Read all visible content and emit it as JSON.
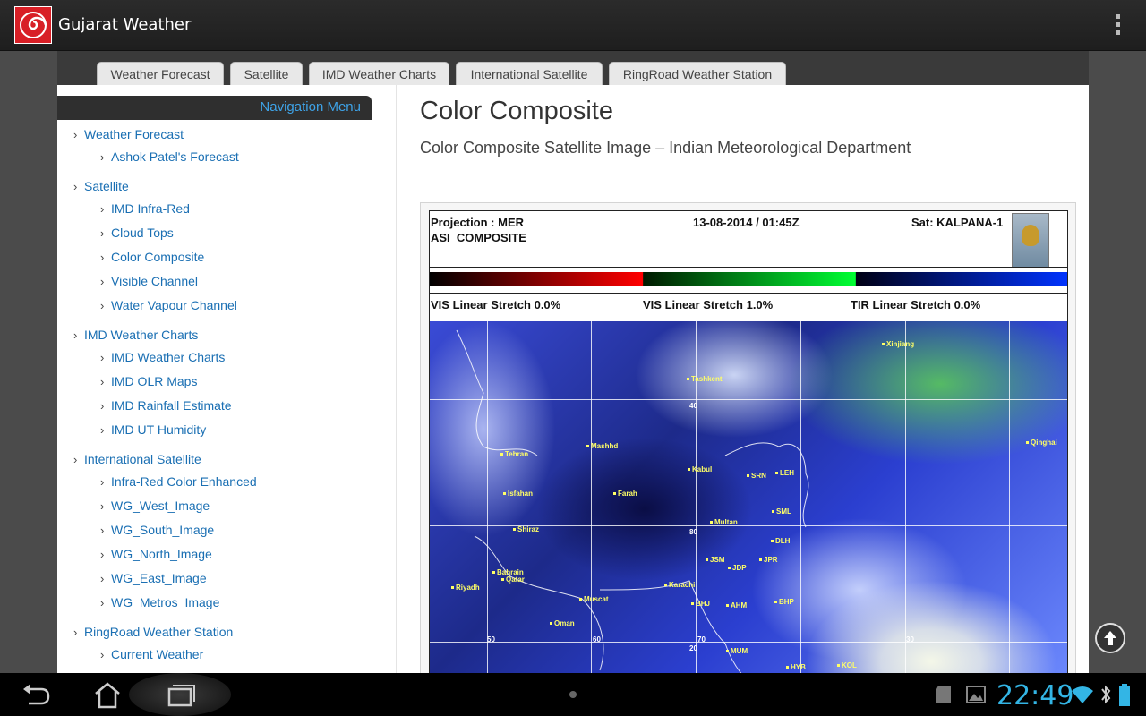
{
  "app": {
    "title": "Gujarat Weather",
    "icon": "spiral-logo-icon"
  },
  "tabs": [
    {
      "label": "Weather Forecast"
    },
    {
      "label": "Satellite"
    },
    {
      "label": "IMD Weather Charts"
    },
    {
      "label": "International Satellite"
    },
    {
      "label": "RingRoad Weather Station"
    }
  ],
  "nav": {
    "heading": "Navigation Menu",
    "items": [
      {
        "label": "Weather Forecast",
        "level": 0
      },
      {
        "label": "Ashok Patel's Forecast",
        "level": 1
      },
      {
        "label": "Satellite",
        "level": 0
      },
      {
        "label": "IMD Infra-Red",
        "level": 1
      },
      {
        "label": "Cloud Tops",
        "level": 1
      },
      {
        "label": "Color Composite",
        "level": 1
      },
      {
        "label": "Visible Channel",
        "level": 1
      },
      {
        "label": "Water Vapour Channel",
        "level": 1
      },
      {
        "label": "IMD Weather Charts",
        "level": 0
      },
      {
        "label": "IMD Weather Charts",
        "level": 1
      },
      {
        "label": "IMD OLR Maps",
        "level": 1
      },
      {
        "label": "IMD Rainfall Estimate",
        "level": 1
      },
      {
        "label": "IMD UT Humidity",
        "level": 1
      },
      {
        "label": "International Satellite",
        "level": 0
      },
      {
        "label": "Infra-Red Color Enhanced",
        "level": 1
      },
      {
        "label": "WG_West_Image",
        "level": 1
      },
      {
        "label": "WG_South_Image",
        "level": 1
      },
      {
        "label": "WG_North_Image",
        "level": 1
      },
      {
        "label": "WG_East_Image",
        "level": 1
      },
      {
        "label": "WG_Metros_Image",
        "level": 1
      },
      {
        "label": "RingRoad Weather Station",
        "level": 0
      },
      {
        "label": "Current Weather",
        "level": 1
      }
    ]
  },
  "content": {
    "title": "Color Composite",
    "subtitle": "Color Composite Satellite Image – Indian Meteorological Department"
  },
  "satellite": {
    "projection": "Projection : MER",
    "product": "ASI_COMPOSITE",
    "datetime": "13-08-2014 / 01:45Z",
    "satellite": "Sat: KALPANA-1",
    "stretch1": "VIS Linear Stretch 0.0%",
    "stretch2": "VIS Linear Stretch 1.0%",
    "stretch3": "TIR Linear Stretch 0.0%",
    "cities": [
      "Xinjiang",
      "Tashkent",
      "Mashhd",
      "Tehran",
      "Kabul",
      "SRN",
      "LEH",
      "Isfahan",
      "Farah",
      "Qinghai",
      "Shiraz",
      "Multan",
      "SML",
      "DLH",
      "Bahrain",
      "Qatar",
      "JSM",
      "JPR",
      "JDP",
      "Riyadh",
      "Karachi",
      "Muscat",
      "BHJ",
      "AHM",
      "BHP",
      "Oman",
      "MUM",
      "HYB",
      "KOL"
    ],
    "degrees": [
      "40",
      "80",
      "50",
      "60",
      "70",
      "20",
      "30"
    ]
  },
  "system": {
    "clock": "22:49"
  }
}
